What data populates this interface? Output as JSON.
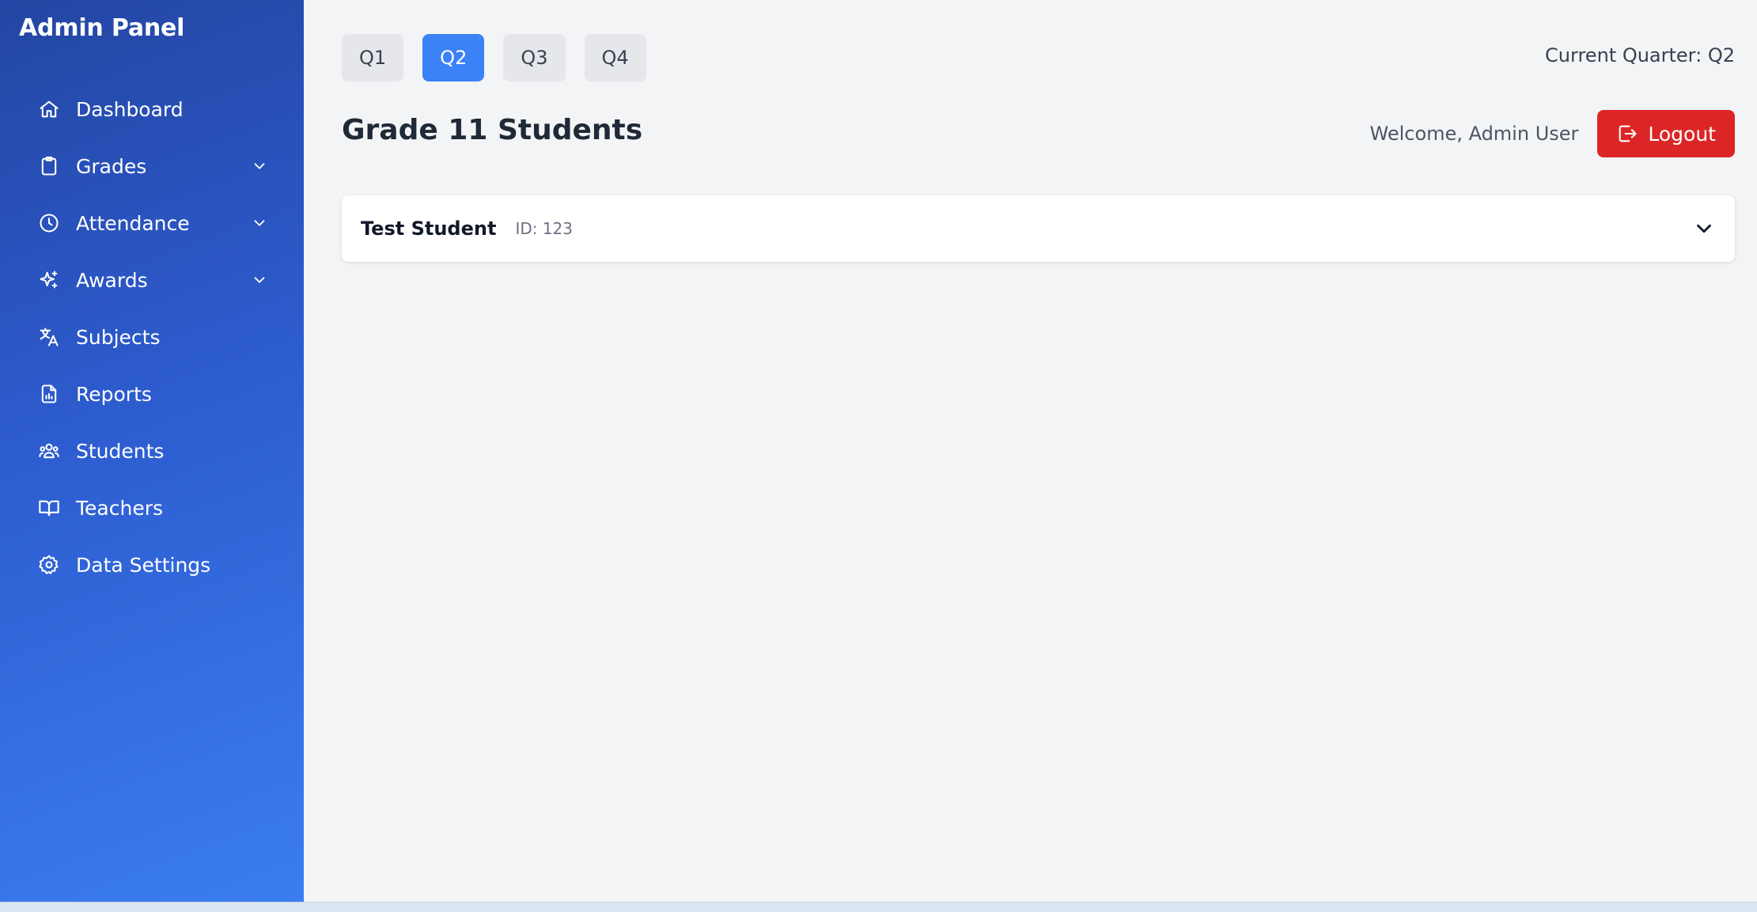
{
  "sidebar": {
    "title": "Admin Panel",
    "items": [
      {
        "label": "Dashboard",
        "icon": "home-icon",
        "expandable": false
      },
      {
        "label": "Grades",
        "icon": "clipboard-icon",
        "expandable": true
      },
      {
        "label": "Attendance",
        "icon": "clock-icon",
        "expandable": true
      },
      {
        "label": "Awards",
        "icon": "sparkles-icon",
        "expandable": true
      },
      {
        "label": "Subjects",
        "icon": "language-icon",
        "expandable": false
      },
      {
        "label": "Reports",
        "icon": "report-icon",
        "expandable": false
      },
      {
        "label": "Students",
        "icon": "users-icon",
        "expandable": false
      },
      {
        "label": "Teachers",
        "icon": "book-icon",
        "expandable": false
      },
      {
        "label": "Data Settings",
        "icon": "gear-icon",
        "expandable": false
      }
    ]
  },
  "quarters": {
    "buttons": [
      "Q1",
      "Q2",
      "Q3",
      "Q4"
    ],
    "active": "Q2",
    "current_label": "Current Quarter: Q2"
  },
  "header": {
    "title": "Grade 11 Students",
    "welcome": "Welcome, Admin User",
    "logout_label": "Logout"
  },
  "students": [
    {
      "name": "Test Student",
      "id_label": "ID: 123"
    }
  ],
  "colors": {
    "sidebar_start": "#2446a3",
    "sidebar_end": "#3a7ef0",
    "active_quarter": "#3b82f6",
    "logout": "#dc2626",
    "background": "#f3f4f6"
  }
}
